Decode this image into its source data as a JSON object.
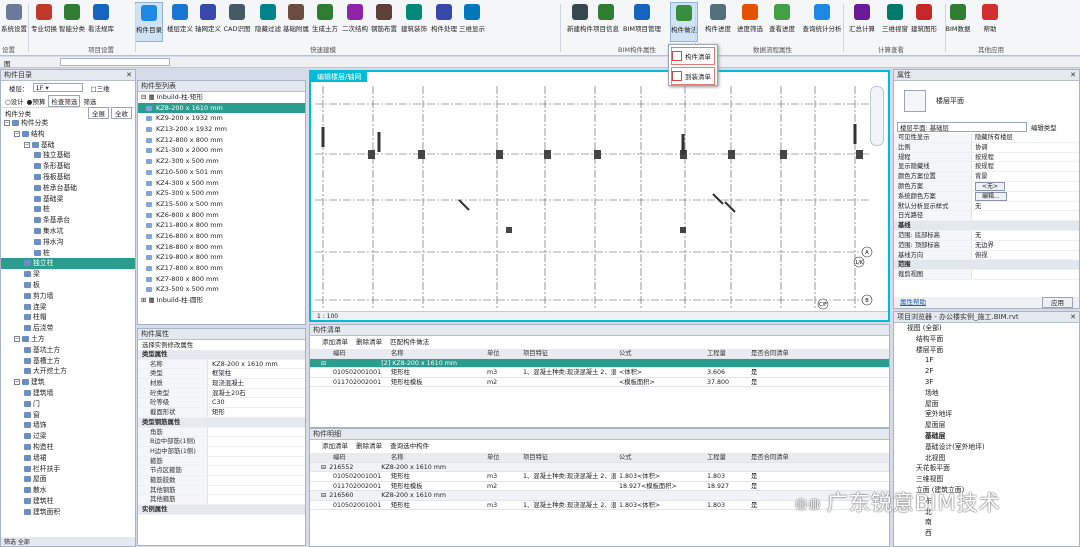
{
  "ribbon": {
    "buttons": [
      "系统设置",
      "专业切换",
      "智能分类",
      "看法规库",
      "构件目录",
      "楼层定义",
      "轴网定义",
      "CAD识图",
      "隐藏过滤",
      "基础附属",
      "生成土方",
      "二次结构",
      "钢筋布置",
      "建筑装饰",
      "构件处理",
      "三维显示",
      "新建构件",
      "项目信息",
      "BIM项目管理",
      "构件做法",
      "构件进度",
      "进度筛选",
      "查看进度",
      "查询统计分析",
      "汇总计算",
      "三维视窗",
      "建筑图形",
      "BIM数据",
      "帮助"
    ],
    "groups": [
      "设置",
      "项目设置",
      "快速建模",
      "BIM构件属性",
      "数据流程属性",
      "计算查看",
      "其他应用"
    ],
    "dropdown": [
      "构件清单",
      "到装清单"
    ]
  },
  "left": {
    "title": "构件目录",
    "floor_label": "楼层：",
    "floor": "1F",
    "three_d": "三维",
    "mode_design": "设计",
    "mode_precast": "预算",
    "check_btn": "检查筛选",
    "filter": "筛选",
    "cat_label": "构件分类",
    "all": "全展",
    "all2": "全收",
    "tree": [
      "构件分类",
      "结构",
      "基础",
      "独立基础",
      "条形基础",
      "筏板基础",
      "桩承台基础",
      "基础梁",
      "桩",
      "条基承台",
      "集水坑",
      "排水沟",
      "桩",
      "独立柱",
      "梁",
      "板",
      "剪力墙",
      "连梁",
      "柱帽",
      "后浇带",
      "土方",
      "基坑土方",
      "基槽土方",
      "大开挖土方",
      "建筑",
      "建筑墙",
      "门",
      "窗",
      "墙饰",
      "过梁",
      "构造柱",
      "墙裙",
      "栏杆扶手",
      "屋面",
      "散水",
      "建筑柱",
      "建筑面积"
    ],
    "footer": "筛选 全部"
  },
  "list": {
    "title": "构件型列表",
    "group1": "Inbuild-柱-矩形",
    "items": [
      "KZ8-200 x 1610 mm",
      "KZ9-200 x 1932 mm",
      "KZ13-200 x 1932 mm",
      "KZ12-800 x 800 mm",
      "KZ1-300 x 2000 mm",
      "KZ2-300 x 500 mm",
      "KZ10-500 x 501 mm",
      "KZ4-300 x 500 mm",
      "KZ5-300 x 500 mm",
      "KZ15-500 x 500 mm",
      "KZ6-800 x 800 mm",
      "KZ11-800 x 800 mm",
      "KZ16-800 x 800 mm",
      "KZ18-800 x 800 mm",
      "KZ19-800 x 800 mm",
      "KZ17-800 x 800 mm",
      "KZ7-800 x 800 mm",
      "KZ3-500 x 500 mm"
    ],
    "group2": "Inbuild-柱-圆形"
  },
  "props": {
    "title": "构件属性",
    "sub": "选择实例修改属性",
    "rows": [
      [
        "sec",
        "类型属性"
      ],
      [
        "名称",
        "KZ8-200 x 1610 mm"
      ],
      [
        "类型",
        "框架柱"
      ],
      [
        "材质",
        "现浇混凝土"
      ],
      [
        "砼类型",
        "混凝土20石"
      ],
      [
        "砼等级",
        "C30"
      ],
      [
        "截面形状",
        "矩形"
      ],
      [
        "sec",
        "类型钢筋属性"
      ],
      [
        "角筋",
        ""
      ],
      [
        "B边中部筋(1侧)",
        ""
      ],
      [
        "H边中部筋(1侧)",
        ""
      ],
      [
        "箍筋",
        ""
      ],
      [
        "节点区箍筋",
        ""
      ],
      [
        "箍筋肢数",
        ""
      ],
      [
        "其他钢筋",
        ""
      ],
      [
        "其他箍筋",
        ""
      ],
      [
        "sec",
        "实例属性"
      ]
    ]
  },
  "canvas": {
    "title": "编辑楼层/轴网",
    "scale": "1 : 100",
    "axis_a": "A",
    "axis_b": "B",
    "axis_1": "1/K",
    "axis_c": "C/F"
  },
  "list_table": {
    "title": "构件清单",
    "tools": [
      "添加清单",
      "删除清单",
      "匹配构件做法"
    ],
    "headers": [
      "编码",
      "名称",
      "单位",
      "项目特征",
      "公式",
      "工程量",
      "是否合同清单"
    ],
    "rows": [
      {
        "t": "gr",
        "c": [
          "",
          "[2] KZ8-200 x 1610 mm",
          "",
          "",
          "",
          "",
          ""
        ]
      },
      {
        "t": "n",
        "c": [
          "010502001001",
          "矩形柱",
          "m3",
          "1、混凝土种类:现浇混凝土 2、混凝土强度等级:C30",
          "<体积>",
          "3.606",
          "是"
        ]
      },
      {
        "t": "n",
        "c": [
          "011702002001",
          "矩形柱模板",
          "m2",
          "",
          "<模板面积>",
          "37.800",
          "是"
        ]
      }
    ]
  },
  "detail_table": {
    "title": "构件明细",
    "tools": [
      "添加清单",
      "删除清单",
      "查询选中构件"
    ],
    "headers": [
      "编码",
      "名称",
      "单位",
      "项目特征",
      "公式",
      "工程量",
      "是否合同清单"
    ],
    "rows": [
      {
        "t": "sg",
        "c": [
          "216552",
          "KZ8-200 x 1610 mm",
          "",
          "",
          "",
          "",
          ""
        ]
      },
      {
        "t": "n",
        "c": [
          "010502001001",
          "矩形柱",
          "m3",
          "1、混凝土种类:现浇混凝土 2、混凝土强度等级:C30",
          "1.803<体积>",
          "1.803",
          "是"
        ]
      },
      {
        "t": "n",
        "c": [
          "011702002001",
          "矩形柱模板",
          "m2",
          "",
          "18.927<模板面积>",
          "18.927",
          "是"
        ]
      },
      {
        "t": "sg",
        "c": [
          "216560",
          "KZ8-200 x 1610 mm",
          "",
          "",
          "",
          "",
          ""
        ]
      },
      {
        "t": "n",
        "c": [
          "010502001001",
          "矩形柱",
          "m3",
          "1、混凝土种类:现浇混凝土 2、混凝土强度等级:C30",
          "1.803<体积>",
          "1.803",
          "是"
        ]
      }
    ]
  },
  "right": {
    "title": "属性",
    "view_label": "楼层平面",
    "sel": "楼层平面: 基础层",
    "edit_type": "编辑类型",
    "rows": [
      [
        "可见性显示",
        "隐藏所有楼层"
      ],
      [
        "比例",
        "协调"
      ],
      [
        "规程",
        "按规程"
      ],
      [
        "显示隐藏线",
        "按规程"
      ],
      [
        "颜色方案位置",
        "背景"
      ],
      [
        "颜色方案",
        "<无>"
      ],
      [
        "系统颜色方案",
        "编辑..."
      ],
      [
        "默认分析显示样式",
        "无"
      ],
      [
        "日光路径",
        ""
      ],
      [
        "sec",
        "基线"
      ],
      [
        "范围: 底部标高",
        "无"
      ],
      [
        "范围: 顶部标高",
        "无边界"
      ],
      [
        "基线方向",
        "俯视"
      ],
      [
        "sec",
        "范围"
      ],
      [
        "裁剪视图",
        ""
      ]
    ],
    "help": "属性帮助",
    "apply": "应用"
  },
  "browser": {
    "title": "项目浏览器 - 办公楼实例_施工.BIM.rvt",
    "tree": [
      "视图 (全部)",
      "结构平面",
      "楼层平面",
      "1F",
      "2F",
      "3F",
      "场地",
      "屋面",
      "室外地坪",
      "屋面层",
      "基础层",
      "基础设计(室外地坪)",
      "北视图",
      "天花板平面",
      "三维视图",
      "立面 (建筑立面)",
      "东",
      "北",
      "南",
      "西"
    ]
  },
  "watermark": "广东锐意BIM技术"
}
